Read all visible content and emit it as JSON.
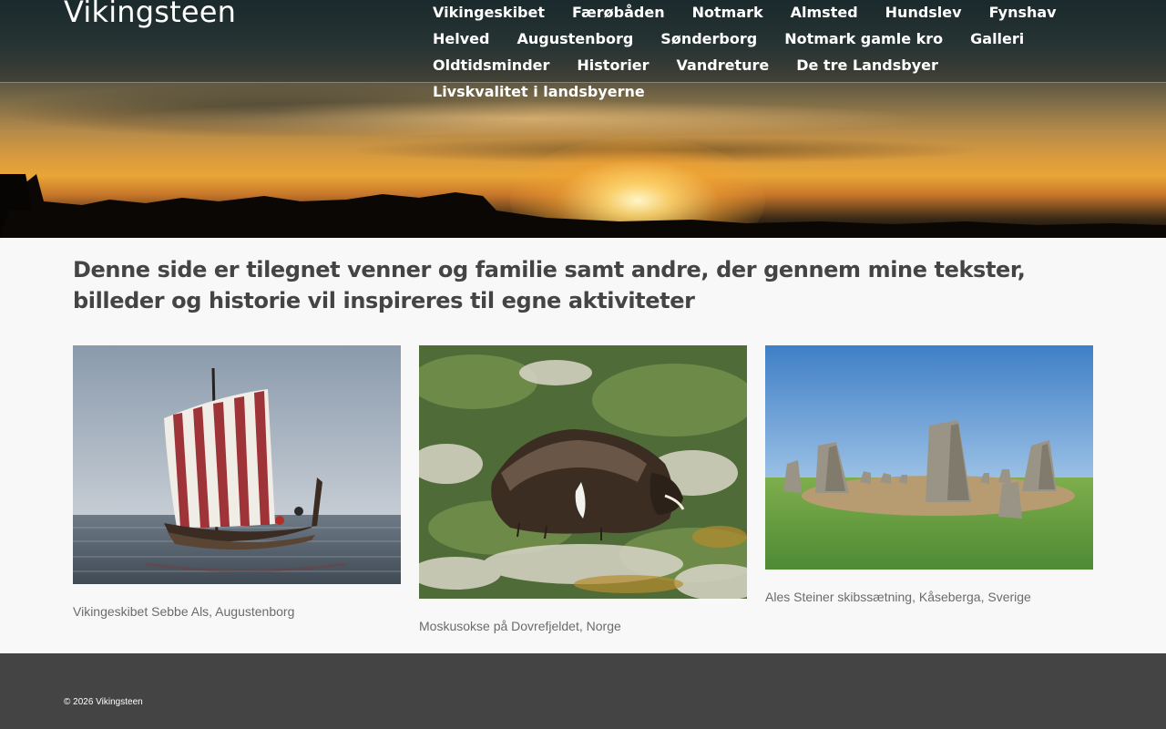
{
  "site": {
    "title": "Vikingsteen"
  },
  "nav": {
    "items": [
      {
        "label": "Vikingeskibet"
      },
      {
        "label": "Færøbåden"
      },
      {
        "label": "Notmark"
      },
      {
        "label": "Almsted"
      },
      {
        "label": "Hundslev"
      },
      {
        "label": "Fynshav"
      },
      {
        "label": "Helved"
      },
      {
        "label": "Augustenborg"
      },
      {
        "label": "Sønderborg"
      },
      {
        "label": "Notmark gamle kro"
      },
      {
        "label": "Galleri"
      },
      {
        "label": "Oldtidsminder"
      },
      {
        "label": "Historier"
      },
      {
        "label": "Vandreture"
      },
      {
        "label": "De tre Landsbyer"
      },
      {
        "label": "Livskvalitet i landsbyerne"
      }
    ]
  },
  "main": {
    "heading": "Denne side er tilegnet venner og familie samt andre, der gennem mine tekster, billeder og historie vil inspireres til egne aktiviteter",
    "cards": [
      {
        "caption": "Vikingeskibet Sebbe Als, Augustenborg",
        "icon": "viking-ship-photo"
      },
      {
        "caption": "Moskusokse på Dovrefjeldet, Norge",
        "icon": "muskox-photo"
      },
      {
        "caption": "Ales Steiner skibssætning, Kåseberga, Sverige",
        "icon": "stone-ship-photo"
      }
    ]
  },
  "footer": {
    "copyright": "© 2026 Vikingsteen"
  },
  "colors": {
    "footer_bg": "#444444",
    "heading": "#444444",
    "caption": "#6b6b6b",
    "page_bg": "#f8f8f8"
  }
}
